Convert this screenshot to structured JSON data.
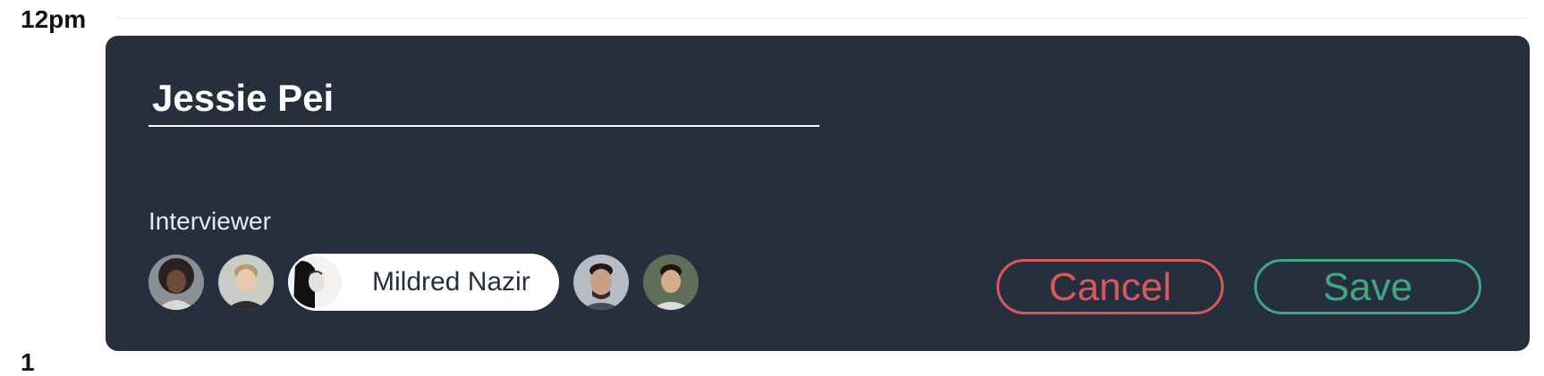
{
  "timeline": {
    "top_label": "12pm",
    "bottom_label": "1"
  },
  "event": {
    "title": "Jessie Pei",
    "interviewer_label": "Interviewer",
    "interviewers": [
      {
        "name": "",
        "icon": "avatar-woman-curly-hair"
      },
      {
        "name": "",
        "icon": "avatar-man-light-hair"
      },
      {
        "name": "Mildred Nazir",
        "icon": "avatar-woman-dark-hair",
        "selected": true
      },
      {
        "name": "",
        "icon": "avatar-man-glasses"
      },
      {
        "name": "",
        "icon": "avatar-man-dark-hair"
      }
    ],
    "cancel_label": "Cancel",
    "save_label": "Save"
  },
  "colors": {
    "card_bg": "#262f3e",
    "cancel": "#d9585a",
    "save": "#3da881"
  }
}
